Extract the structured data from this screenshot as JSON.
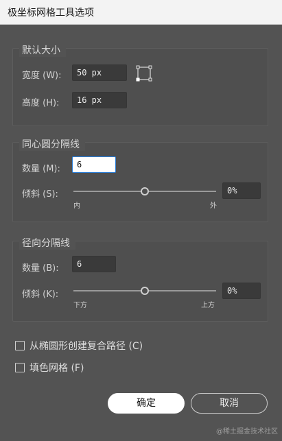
{
  "window": {
    "title": "极坐标网格工具选项"
  },
  "default_size": {
    "legend": "默认大小",
    "width_label": "宽度 (W):",
    "width_value": "50 px",
    "height_label": "高度 (H):",
    "height_value": "16 px",
    "reference_point_icon": "reference-point-icon"
  },
  "concentric": {
    "legend": "同心圆分隔线",
    "count_label": "数量 (M):",
    "count_value": "6",
    "skew_label": "倾斜 (S):",
    "skew_value": "0%",
    "slider_min_label": "内",
    "slider_max_label": "外",
    "slider_position": 0.5
  },
  "radial": {
    "legend": "径向分隔线",
    "count_label": "数量 (B):",
    "count_value": "6",
    "skew_label": "倾斜 (K):",
    "skew_value": "0%",
    "slider_min_label": "下方",
    "slider_max_label": "上方",
    "slider_position": 0.5
  },
  "options": {
    "compound_path_label": "从椭圆形创建复合路径 (C)",
    "compound_path_checked": false,
    "fill_grid_label": "填色网格 (F)",
    "fill_grid_checked": false
  },
  "buttons": {
    "ok": "确定",
    "cancel": "取消"
  },
  "watermark": "@稀土掘金技术社区",
  "colors": {
    "panel": "#535353",
    "field": "#3a3a3a",
    "focus": "#2b7fd9"
  }
}
